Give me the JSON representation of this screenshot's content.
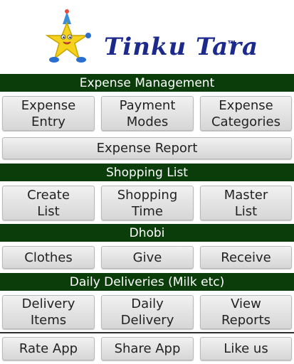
{
  "logo": {
    "name": "Tinku Tara",
    "trademark": "™"
  },
  "sections": [
    {
      "title": "Expense Management"
    },
    {
      "title": "Shopping List"
    },
    {
      "title": "Dhobi"
    },
    {
      "title": "Daily Deliveries (Milk etc)"
    }
  ],
  "buttons": {
    "expense_entry": "Expense\nEntry",
    "payment_modes": "Payment\nModes",
    "expense_categories": "Expense\nCategories",
    "expense_report": "Expense Report",
    "create_list": "Create\nList",
    "shopping_time": "Shopping\nTime",
    "master_list": "Master\nList",
    "clothes": "Clothes",
    "give": "Give",
    "receive": "Receive",
    "delivery_items": "Delivery\nItems",
    "daily_delivery": "Daily\nDelivery",
    "view_reports": "View\nReports",
    "rate_app": "Rate App",
    "share_app": "Share App",
    "like_us": "Like us"
  },
  "colors": {
    "header_bg": "#0b3d0b",
    "logo_text": "#1c2a8c",
    "star": "#f5d21c"
  }
}
